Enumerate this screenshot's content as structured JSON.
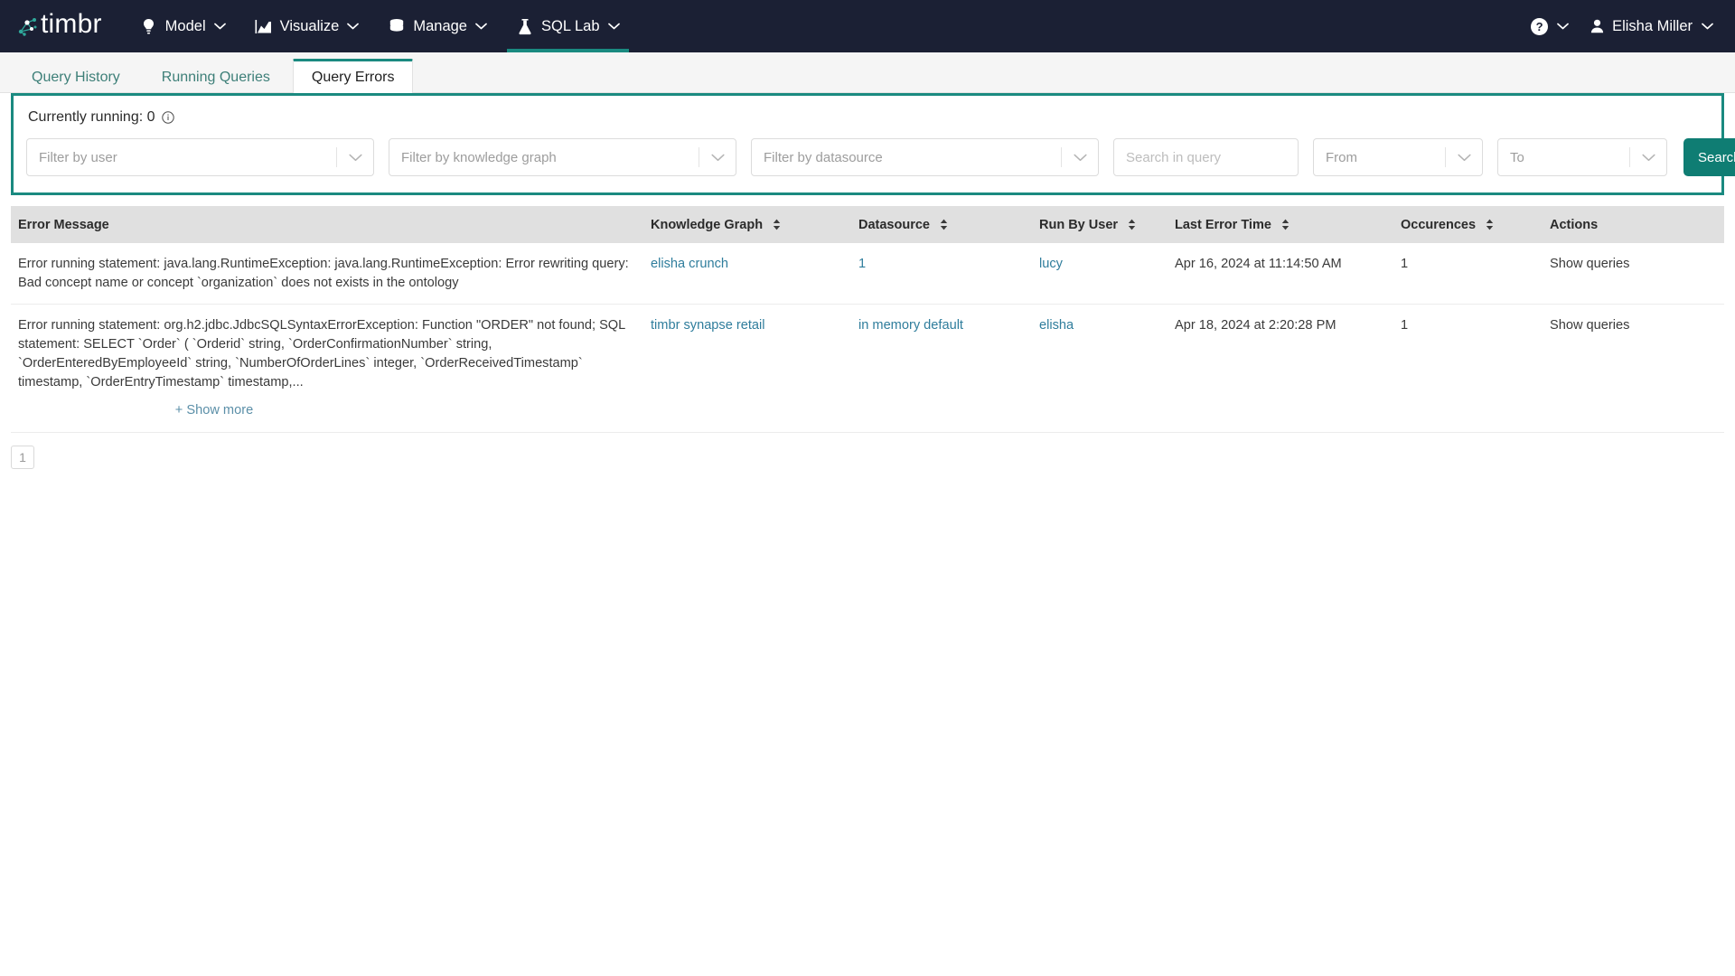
{
  "header": {
    "brand": "timbr",
    "nav": [
      {
        "label": "Model",
        "icon": "lightbulb-icon",
        "active": false
      },
      {
        "label": "Visualize",
        "icon": "chart-icon",
        "active": false
      },
      {
        "label": "Manage",
        "icon": "database-icon",
        "active": false
      },
      {
        "label": "SQL Lab",
        "icon": "flask-icon",
        "active": true
      }
    ],
    "help_label": "?",
    "user_name": "Elisha Miller"
  },
  "tabs": [
    {
      "label": "Query History",
      "active": false
    },
    {
      "label": "Running Queries",
      "active": false
    },
    {
      "label": "Query Errors",
      "active": true
    }
  ],
  "filters": {
    "running_label": "Currently running: 0",
    "user_placeholder": "Filter by user",
    "kg_placeholder": "Filter by knowledge graph",
    "ds_placeholder": "Filter by datasource",
    "query_placeholder": "Search in query",
    "query_value": "",
    "from_placeholder": "From",
    "to_placeholder": "To",
    "search_label": "Search"
  },
  "table": {
    "columns": [
      {
        "label": "Error Message",
        "sortable": false
      },
      {
        "label": "Knowledge Graph",
        "sortable": true
      },
      {
        "label": "Datasource",
        "sortable": true
      },
      {
        "label": "Run By User",
        "sortable": true
      },
      {
        "label": "Last Error Time",
        "sortable": true
      },
      {
        "label": "Occurences",
        "sortable": true
      },
      {
        "label": "Actions",
        "sortable": false
      }
    ],
    "rows": [
      {
        "error": "Error running statement: java.lang.RuntimeException: java.lang.RuntimeException: Error rewriting query: Bad concept name or concept `organization` does not exists in the ontology",
        "show_more": "",
        "knowledge_graph": "elisha crunch",
        "datasource": "1",
        "run_by_user": "lucy",
        "last_error_time": "Apr 16, 2024 at 11:14:50 AM",
        "occurences": "1",
        "action": "Show queries"
      },
      {
        "error": "Error running statement: org.h2.jdbc.JdbcSQLSyntaxErrorException: Function \"ORDER\" not found; SQL statement: SELECT `Order` ( `Orderid` string, `OrderConfirmationNumber` string, `OrderEnteredByEmployeeId` string, `NumberOfOrderLines` integer, `OrderReceivedTimestamp` timestamp, `OrderEntryTimestamp` timestamp,...",
        "show_more": "+ Show more",
        "knowledge_graph": "timbr synapse retail",
        "datasource": "in memory default",
        "run_by_user": "elisha",
        "last_error_time": "Apr 18, 2024 at 2:20:28 PM",
        "occurences": "1",
        "action": "Show queries"
      }
    ]
  },
  "pagination": {
    "pages": [
      "1"
    ],
    "current": "1"
  },
  "colors": {
    "nav_bg": "#1b2034",
    "accent_teal": "#1a8a80",
    "button_teal": "#0f7d73",
    "link_blue": "#2f7d9c",
    "table_header_bg": "#e0e0e0"
  }
}
